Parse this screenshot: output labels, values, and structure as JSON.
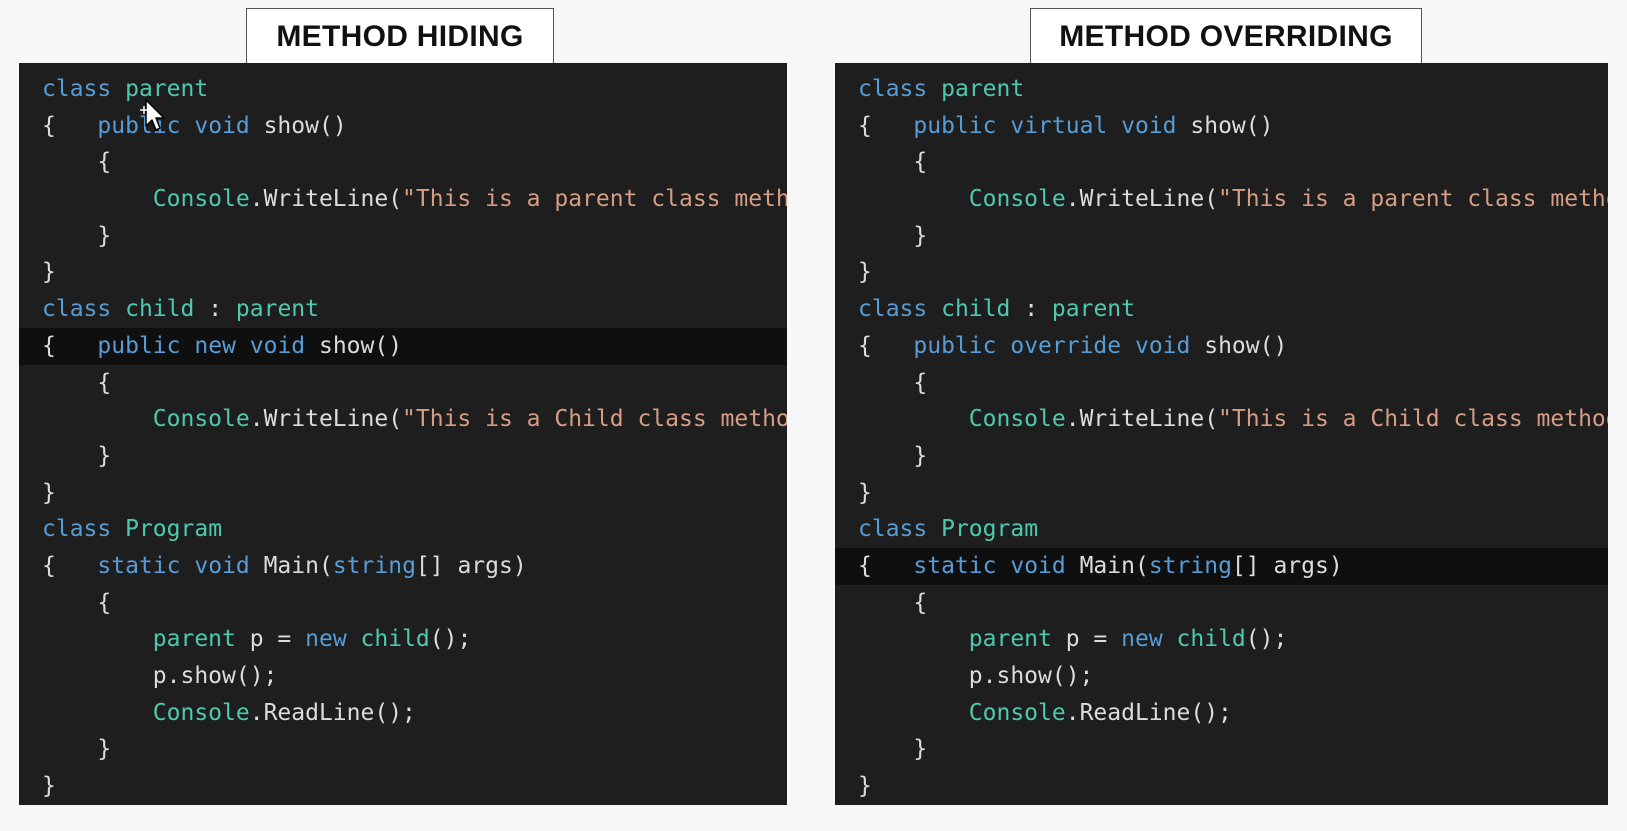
{
  "titles": {
    "left": "METHOD HIDING",
    "right": "METHOD OVERRIDING"
  },
  "colors": {
    "keyword": "#569cd6",
    "type": "#4ec9b0",
    "string": "#d69d85",
    "plain": "#dcdcdc",
    "editor_background": "#1e1e1e"
  },
  "hiding_code": [
    [
      [
        "kw",
        "class"
      ],
      [
        "pl",
        " "
      ],
      [
        "ty",
        "parent"
      ]
    ],
    [
      [
        "pl",
        "{   "
      ],
      [
        "kw",
        "public"
      ],
      [
        "pl",
        " "
      ],
      [
        "kw",
        "void"
      ],
      [
        "pl",
        " show()"
      ]
    ],
    [
      [
        "pl",
        "    {"
      ]
    ],
    [
      [
        "pl",
        "        "
      ],
      [
        "ty",
        "Console"
      ],
      [
        "pl",
        ".WriteLine("
      ],
      [
        "st",
        "\"This is a parent class method\""
      ],
      [
        "pl",
        ");"
      ]
    ],
    [
      [
        "pl",
        "    }"
      ]
    ],
    [
      [
        "pl",
        "}"
      ]
    ],
    [
      [
        "kw",
        "class"
      ],
      [
        "pl",
        " "
      ],
      [
        "ty",
        "child"
      ],
      [
        "pl",
        " : "
      ],
      [
        "ty",
        "parent"
      ]
    ],
    [
      [
        "pl",
        "{   "
      ],
      [
        "kw",
        "public"
      ],
      [
        "pl",
        " "
      ],
      [
        "kw",
        "new"
      ],
      [
        "pl",
        " "
      ],
      [
        "kw",
        "void"
      ],
      [
        "pl",
        " show()"
      ]
    ],
    [
      [
        "pl",
        "    {"
      ]
    ],
    [
      [
        "pl",
        "        "
      ],
      [
        "ty",
        "Console"
      ],
      [
        "pl",
        ".WriteLine("
      ],
      [
        "st",
        "\"This is a Child class method\""
      ],
      [
        "pl",
        ");"
      ]
    ],
    [
      [
        "pl",
        "    }"
      ]
    ],
    [
      [
        "pl",
        "}"
      ]
    ],
    [
      [
        "kw",
        "class"
      ],
      [
        "pl",
        " "
      ],
      [
        "ty",
        "Program"
      ]
    ],
    [
      [
        "pl",
        "{   "
      ],
      [
        "kw",
        "static"
      ],
      [
        "pl",
        " "
      ],
      [
        "kw",
        "void"
      ],
      [
        "pl",
        " Main("
      ],
      [
        "kw",
        "string"
      ],
      [
        "pl",
        "[] args)"
      ]
    ],
    [
      [
        "pl",
        "    {"
      ]
    ],
    [
      [
        "pl",
        "        "
      ],
      [
        "ty",
        "parent"
      ],
      [
        "pl",
        " p = "
      ],
      [
        "kw",
        "new"
      ],
      [
        "pl",
        " "
      ],
      [
        "ty",
        "child"
      ],
      [
        "pl",
        "();"
      ]
    ],
    [
      [
        "pl",
        "        p.show();"
      ]
    ],
    [
      [
        "pl",
        "        "
      ],
      [
        "ty",
        "Console"
      ],
      [
        "pl",
        ".ReadLine();"
      ]
    ],
    [
      [
        "pl",
        "    }"
      ]
    ],
    [
      [
        "pl",
        "}"
      ]
    ]
  ],
  "overriding_code": [
    [
      [
        "kw",
        "class"
      ],
      [
        "pl",
        " "
      ],
      [
        "ty",
        "parent"
      ]
    ],
    [
      [
        "pl",
        "{   "
      ],
      [
        "kw",
        "public"
      ],
      [
        "pl",
        " "
      ],
      [
        "kw",
        "virtual"
      ],
      [
        "pl",
        " "
      ],
      [
        "kw",
        "void"
      ],
      [
        "pl",
        " show()"
      ]
    ],
    [
      [
        "pl",
        "    {"
      ]
    ],
    [
      [
        "pl",
        "        "
      ],
      [
        "ty",
        "Console"
      ],
      [
        "pl",
        ".WriteLine("
      ],
      [
        "st",
        "\"This is a parent class method\""
      ],
      [
        "pl",
        ");"
      ]
    ],
    [
      [
        "pl",
        "    }"
      ]
    ],
    [
      [
        "pl",
        "}"
      ]
    ],
    [
      [
        "kw",
        "class"
      ],
      [
        "pl",
        " "
      ],
      [
        "ty",
        "child"
      ],
      [
        "pl",
        " : "
      ],
      [
        "ty",
        "parent"
      ]
    ],
    [
      [
        "pl",
        "{   "
      ],
      [
        "kw",
        "public"
      ],
      [
        "pl",
        " "
      ],
      [
        "kw",
        "override"
      ],
      [
        "pl",
        " "
      ],
      [
        "kw",
        "void"
      ],
      [
        "pl",
        " show()"
      ]
    ],
    [
      [
        "pl",
        "    {"
      ]
    ],
    [
      [
        "pl",
        "        "
      ],
      [
        "ty",
        "Console"
      ],
      [
        "pl",
        ".WriteLine("
      ],
      [
        "st",
        "\"This is a Child class method\""
      ],
      [
        "pl",
        ");"
      ]
    ],
    [
      [
        "pl",
        "    }"
      ]
    ],
    [
      [
        "pl",
        "}"
      ]
    ],
    [
      [
        "kw",
        "class"
      ],
      [
        "pl",
        " "
      ],
      [
        "ty",
        "Program"
      ]
    ],
    [
      [
        "pl",
        "{   "
      ],
      [
        "kw",
        "static"
      ],
      [
        "pl",
        " "
      ],
      [
        "kw",
        "void"
      ],
      [
        "pl",
        " Main("
      ],
      [
        "kw",
        "string"
      ],
      [
        "pl",
        "[] args)"
      ]
    ],
    [
      [
        "pl",
        "    {"
      ]
    ],
    [
      [
        "pl",
        "        "
      ],
      [
        "ty",
        "parent"
      ],
      [
        "pl",
        " p = "
      ],
      [
        "kw",
        "new"
      ],
      [
        "pl",
        " "
      ],
      [
        "ty",
        "child"
      ],
      [
        "pl",
        "();"
      ]
    ],
    [
      [
        "pl",
        "        p.show();"
      ]
    ],
    [
      [
        "pl",
        "        "
      ],
      [
        "ty",
        "Console"
      ],
      [
        "pl",
        ".ReadLine();"
      ]
    ],
    [
      [
        "pl",
        "    }"
      ]
    ],
    [
      [
        "pl",
        "}"
      ]
    ]
  ],
  "highlighted_lines": {
    "hiding": 7,
    "overriding": 13
  },
  "icons": {
    "cursor": "mouse-cursor-icon"
  }
}
